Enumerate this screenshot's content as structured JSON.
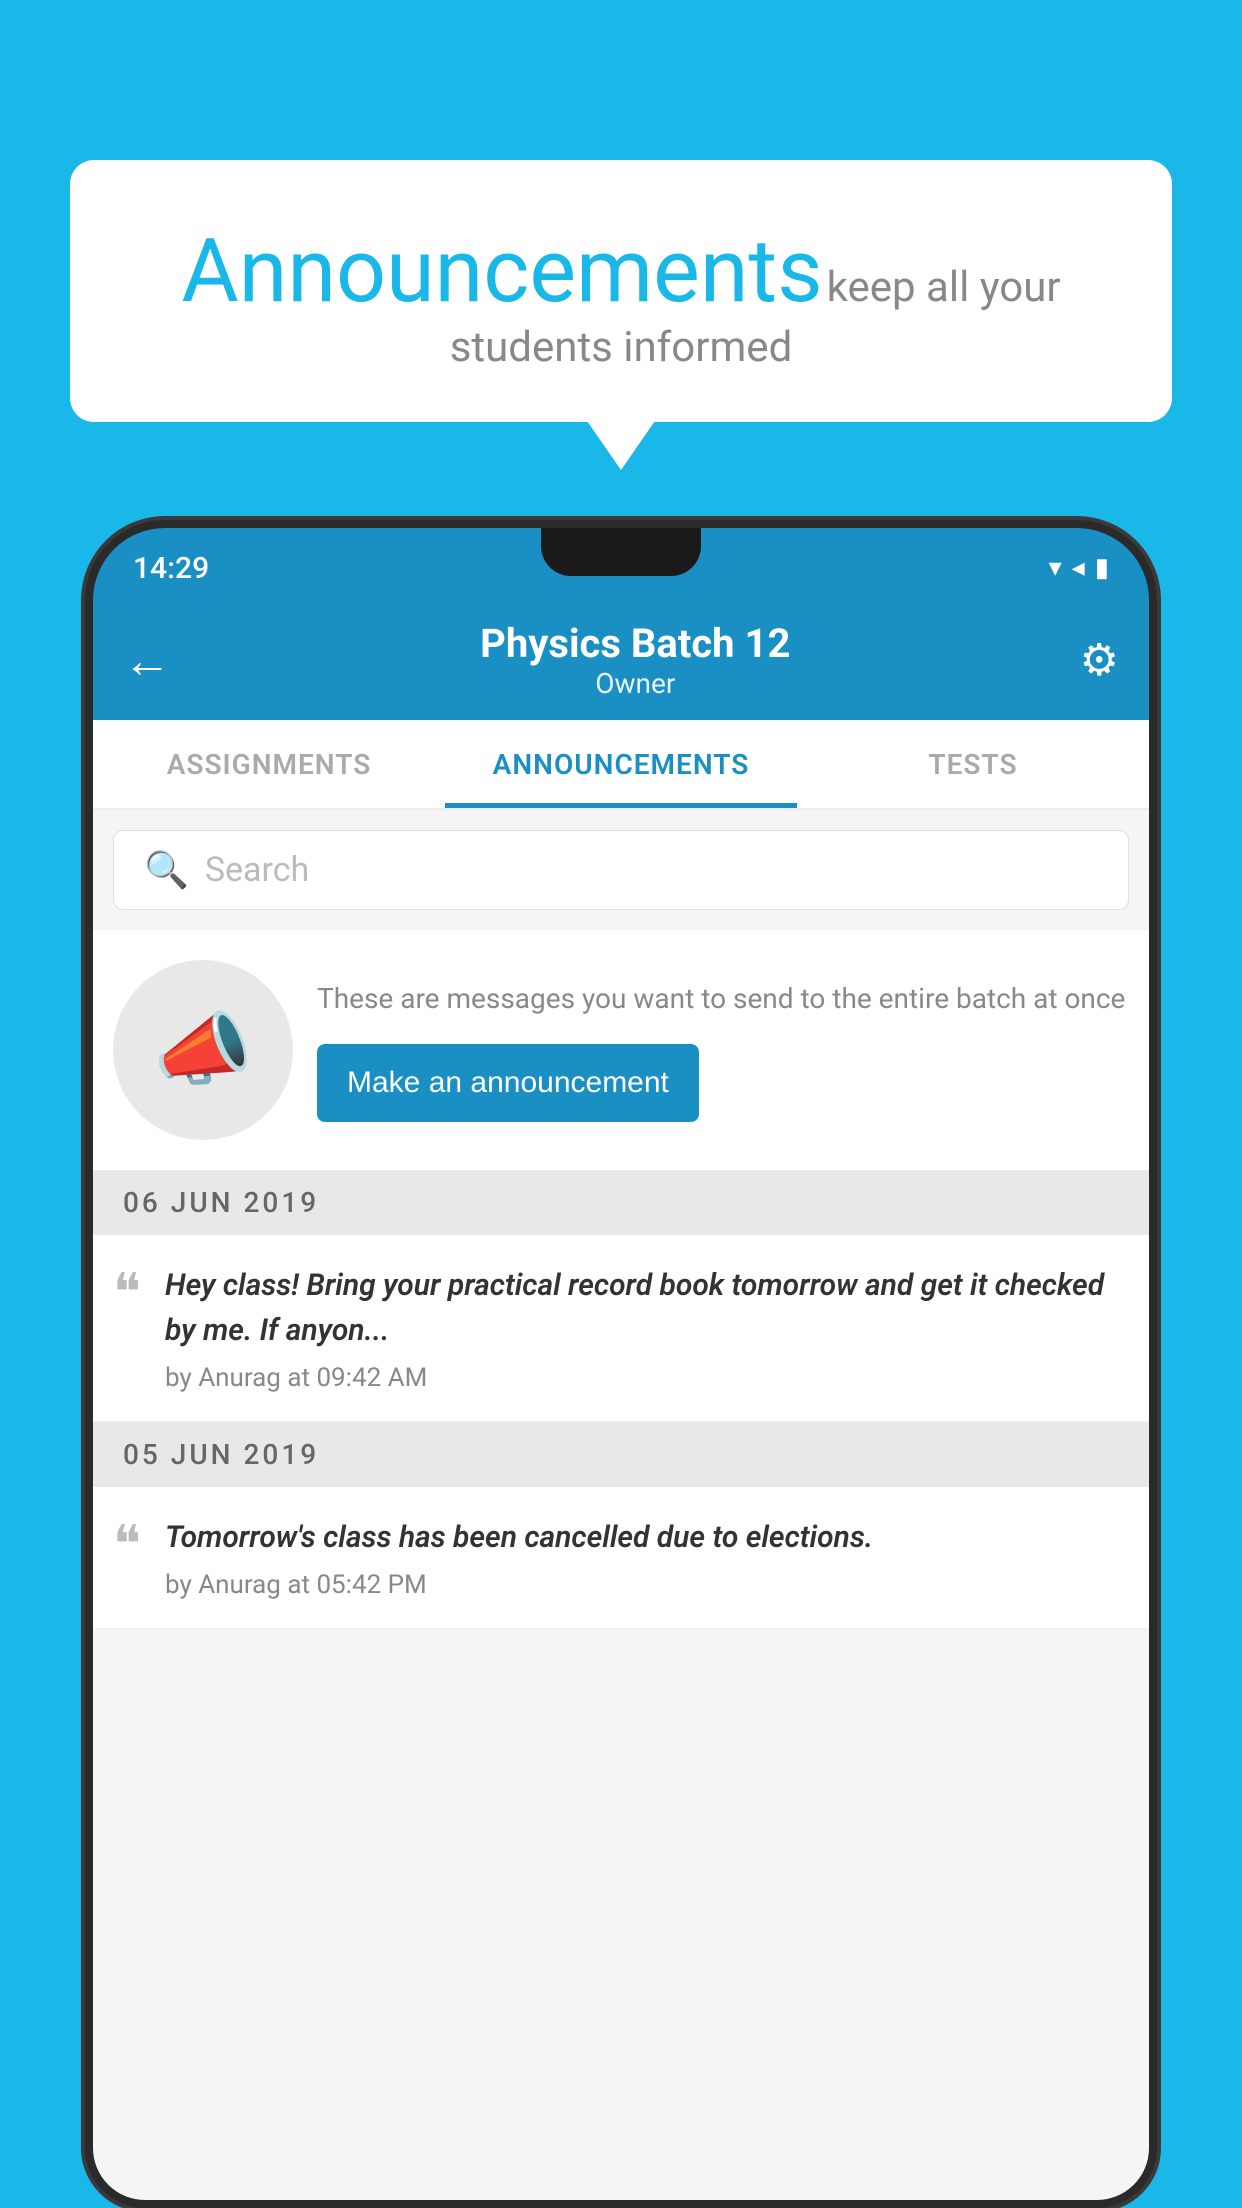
{
  "bubble": {
    "title": "Announcements",
    "subtitle": "keep all your students informed"
  },
  "status_bar": {
    "time": "14:29",
    "icons": "▾◂▮"
  },
  "app_bar": {
    "title": "Physics Batch 12",
    "subtitle": "Owner",
    "back_label": "←",
    "gear_label": "⚙"
  },
  "tabs": [
    {
      "label": "ASSIGNMENTS",
      "active": false
    },
    {
      "label": "ANNOUNCEMENTS",
      "active": true
    },
    {
      "label": "TESTS",
      "active": false
    }
  ],
  "search": {
    "placeholder": "Search"
  },
  "promo": {
    "description": "These are messages you want to send to the entire batch at once",
    "button_label": "Make an announcement"
  },
  "announcements": [
    {
      "date": "06  JUN  2019",
      "text": "Hey class! Bring your practical record book tomorrow and get it checked by me. If anyon...",
      "meta": "by Anurag at 09:42 AM"
    },
    {
      "date": "05  JUN  2019",
      "text": "Tomorrow's class has been cancelled due to elections.",
      "meta": "by Anurag at 05:42 PM"
    }
  ],
  "colors": {
    "bg": "#1ab8e8",
    "app_bar": "#1a8fc4",
    "active_tab": "#1a8fc4",
    "btn": "#1a8fc4",
    "white": "#ffffff"
  }
}
